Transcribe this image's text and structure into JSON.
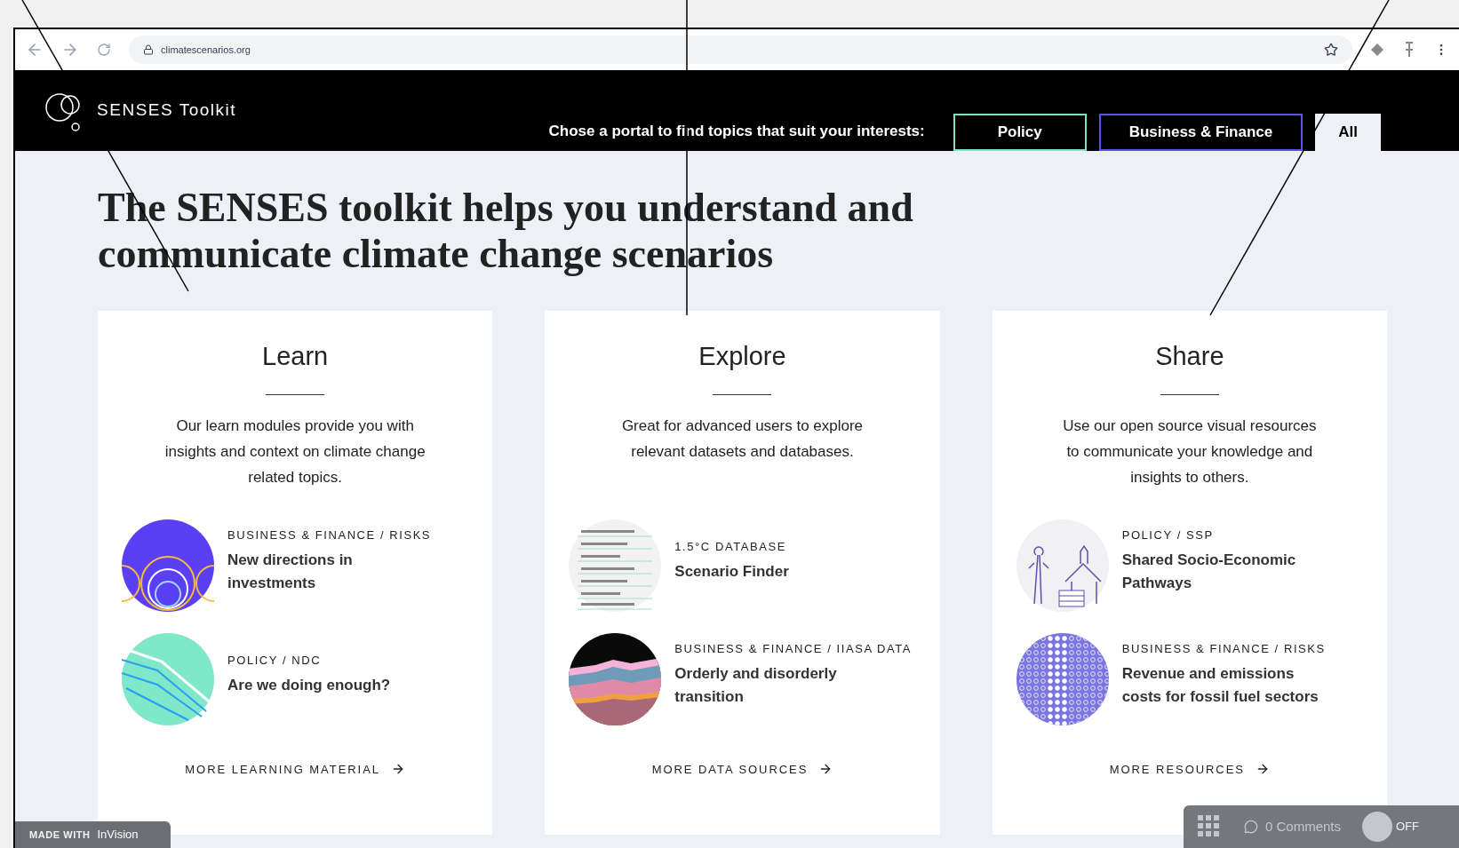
{
  "browser": {
    "url": "climatescenarios.org"
  },
  "header": {
    "logo_text": "SENSES Toolkit",
    "prompt": "Chose a portal to find topics that suit your interests:",
    "portals": [
      {
        "label": "Policy",
        "selected": false,
        "color": "#7fe3c0"
      },
      {
        "label": "Business & Finance",
        "selected": false,
        "color": "#5b4ff5"
      },
      {
        "label": "All",
        "selected": true,
        "color": "#eef0f8"
      }
    ]
  },
  "headline": "The SENSES toolkit helps you understand and communicate climate change scenarios",
  "cards": [
    {
      "title": "Learn",
      "description": "Our learn modules provide you with insights and context on climate change related topics.",
      "items": [
        {
          "kind": "rings",
          "category": "BUSINESS & FINANCE / RISKS",
          "title": "New directions in investments"
        },
        {
          "kind": "lines",
          "category": "POLICY / NDC",
          "title": "Are we doing enough?"
        }
      ],
      "more_link": "MORE LEARNING MATERIAL"
    },
    {
      "title": "Explore",
      "description": "Great for advanced users to explore relevant  datasets and databases.",
      "items": [
        {
          "kind": "table",
          "category": "1.5°C DATABASE",
          "title": "Scenario Finder"
        },
        {
          "kind": "area",
          "category": "BUSINESS & FINANCE / IIASA DATA",
          "title": "Orderly and disorderly transition"
        }
      ],
      "more_link": "MORE DATA SOURCES"
    },
    {
      "title": "Share",
      "description": "Use our open source visual resources to communicate your knowledge and insights to others.",
      "items": [
        {
          "kind": "town",
          "category": "POLICY / SSP",
          "title": "Shared Socio-Economic Pathways"
        },
        {
          "kind": "dots",
          "category": "BUSINESS & FINANCE / RISKS",
          "title": "Revenue and emissions costs for fossil fuel sectors"
        }
      ],
      "more_link": "MORE RESOURCES"
    }
  ],
  "overlays": {
    "badge_prefix": "MADE WITH",
    "badge_brand": "InVision",
    "comments": "0 Comments",
    "toggle": {
      "label": "OFF",
      "on": false
    }
  }
}
